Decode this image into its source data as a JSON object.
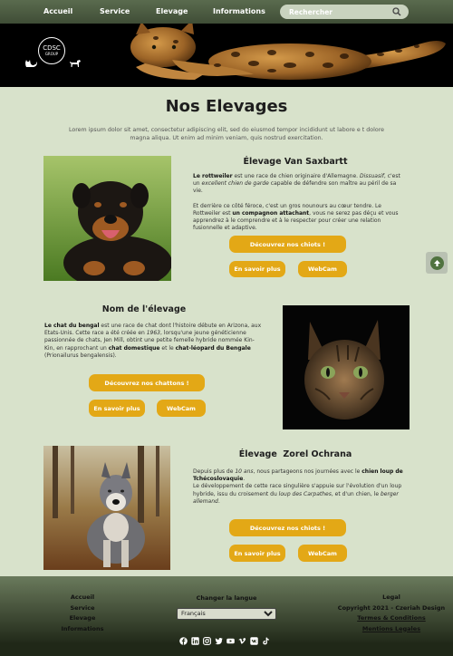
{
  "nav": {
    "items": [
      {
        "label": "Accueil"
      },
      {
        "label": "Service"
      },
      {
        "label": "Elevage"
      },
      {
        "label": "Informations"
      }
    ],
    "search_placeholder": "Rechercher",
    "search_icon": "search-icon"
  },
  "banner": {
    "logo_main": "CDSC",
    "logo_sub": "GROUP"
  },
  "page": {
    "title": "Nos Elevages",
    "intro": "Lorem ipsum dolor sit amet, consectetur adipiscing elit, sed do eiusmod tempor incididunt ut labore e t dolore magna aliqua. Ut enim ad minim veniam, quis nostrud exercitation."
  },
  "sections": [
    {
      "title": "Élevage Van Saxbartt",
      "p1": "Le rottweiler est une race de chien originaire d'Allemagne. Dissuasif, c'est un excellent chien de garde capable de défendre son maître au péril de sa vie.",
      "p2": "Et derrière ce côté féroce, c'est un gros nounours au cœur tendre. Le Rottweiler est un compagnon attachant, vous ne serez pas déçu et vous apprendrez à le comprendre et à le respecter pour créer une relation fusionnelle et adaptive.",
      "cta": "Découvrez nos chiots !",
      "more": "En savoir plus",
      "webcam": "WebCam",
      "photo": "rottweiler-photo"
    },
    {
      "title": "Nom de l'élevage",
      "p1": "Le chat du bengal est une race de chat dont l'histoire débute en Arizona, aux Etats-Unis. Cette race a été créée en 1963, lorsqu'une jeune généticienne passionnée de chats, Jen Mill, obtint une petite femelle hybride nommée Kin-Kin, en rapprochant un chat domestique et le chat-léopard du Bengale (Prionailurus bengalensis).",
      "cta": "Découvrez nos chattons !",
      "more": "En savoir plus",
      "webcam": "WebCam",
      "photo": "bengal-cat-photo"
    },
    {
      "title": "Élevage  Zorel Ochrana",
      "p1": "Depuis plus de 10 ans, nous partageons nos journées avec le chien loup de Tchécoslovaquie.",
      "p2": "Le développement de cette race singulière s'appuie sur l'évolution d'un loup hybride, issu du croisement du loup des Carpathes, et d'un chien, le berger allemand.",
      "cta": "Découvrez nos chiots !",
      "more": "En savoir plus",
      "webcam": "WebCam",
      "photo": "wolfdog-photo"
    }
  ],
  "footer": {
    "links": [
      "Accueil",
      "Service",
      "Elevage",
      "Informations"
    ],
    "lang_label": "Changer la langue",
    "lang_selected": "Français",
    "legal_title": "Legal",
    "copyright": "Copyright 2021 - Czeriah Design",
    "terms": "Termes & Conditions",
    "mentions": "Mentions Legales",
    "socials": [
      "facebook-icon",
      "linkedin-icon",
      "instagram-icon",
      "twitter-icon",
      "youtube-icon",
      "vimeo-icon",
      "vk-icon",
      "tiktok-icon"
    ]
  },
  "colors": {
    "background": "#d8e2cb",
    "nav": "#4b5a40",
    "button": "#e3a816",
    "footer": "#3a4630"
  }
}
